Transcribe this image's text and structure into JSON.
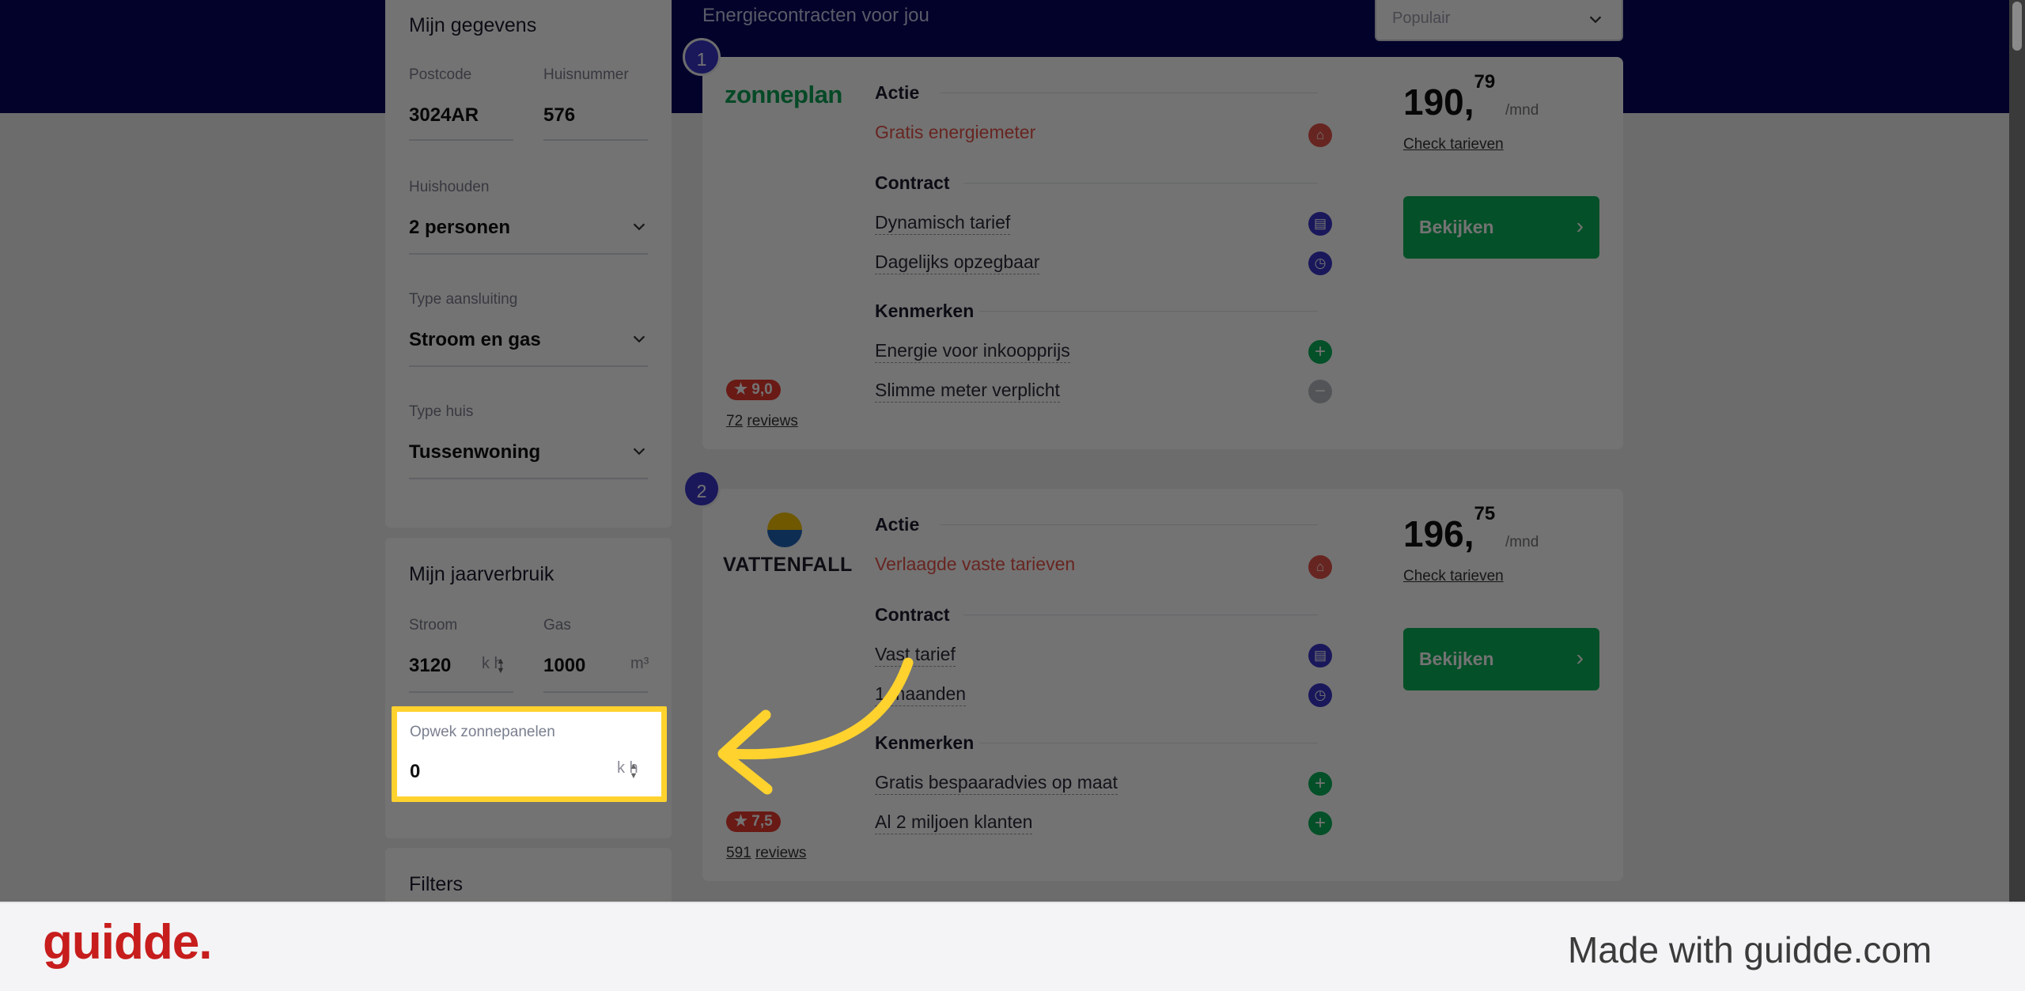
{
  "results": {
    "title": "Energiecontracten voor jou",
    "sort_value": "Populair"
  },
  "sidebar": {
    "gegevens": {
      "title": "Mijn gegevens",
      "postcode_label": "Postcode",
      "postcode_value": "3024AR",
      "huisnummer_label": "Huisnummer",
      "huisnummer_value": "576",
      "huishouden_label": "Huishouden",
      "huishouden_value": "2 personen",
      "aansluiting_label": "Type aansluiting",
      "aansluiting_value": "Stroom en gas",
      "huis_label": "Type huis",
      "huis_value": "Tussenwoning"
    },
    "verbruik": {
      "title": "Mijn jaarverbruik",
      "stroom_label": "Stroom",
      "stroom_value": "3120",
      "stroom_unit": "k  h",
      "gas_label": "Gas",
      "gas_value": "1000",
      "gas_unit": "m³",
      "zon_label": "Opwek zonnepanelen",
      "zon_value": "0",
      "zon_unit": "k  h"
    },
    "filters": {
      "title": "Filters"
    }
  },
  "cards": [
    {
      "rank": "1",
      "provider": "zonneplan",
      "actie_title": "Actie",
      "actie": "Gratis energiemeter",
      "contract_title": "Contract",
      "contract_items": [
        "Dynamisch tarief",
        "Dagelijks opzegbaar"
      ],
      "kenmerken_title": "Kenmerken",
      "kenmerken_items": [
        "Energie voor inkoopprijs",
        "Slimme meter verplicht"
      ],
      "price_main": "190,",
      "price_cents": "79",
      "price_unit": "/mnd",
      "check_label": "Check tarieven",
      "button_label": "Bekijken",
      "rating": "★ 9,0",
      "reviews_count": "72",
      "reviews_label": "reviews"
    },
    {
      "rank": "2",
      "provider": "VATTENFALL",
      "actie_title": "Actie",
      "actie": "Verlaagde vaste tarieven",
      "contract_title": "Contract",
      "contract_items": [
        "Vast tarief",
        "1  maanden"
      ],
      "kenmerken_title": "Kenmerken",
      "kenmerken_items": [
        "Gratis bespaaradvies op maat",
        "Al 2 miljoen klanten"
      ],
      "price_main": "196,",
      "price_cents": "75",
      "price_unit": "/mnd",
      "check_label": "Check tarieven",
      "button_label": "Bekijken",
      "rating": "★ 7,5",
      "reviews_count": "591",
      "reviews_label": "reviews"
    }
  ],
  "footer": {
    "brand": "guidde.",
    "tagline": "Made with guidde.com"
  },
  "colors": {
    "hero": "#05055e",
    "accent_green": "#0bb25a",
    "rank_purple": "#3b36c9",
    "promo_red": "#e5534b",
    "highlight_yellow": "#ffd22e",
    "guidde_red": "#c71d1d"
  }
}
